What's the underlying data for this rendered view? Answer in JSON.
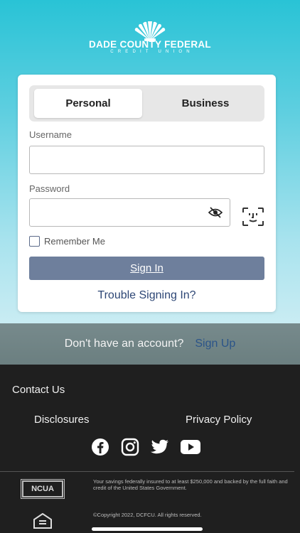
{
  "brand": {
    "name": "DADE COUNTY FEDERAL",
    "subtitle": "CREDIT UNION"
  },
  "login": {
    "tabs": [
      {
        "label": "Personal",
        "active": true
      },
      {
        "label": "Business",
        "active": false
      }
    ],
    "username_label": "Username",
    "username_value": "",
    "password_label": "Password",
    "password_value": "",
    "remember_label": "Remember Me",
    "remember_checked": false,
    "signin_label": "Sign In",
    "trouble_label": "Trouble Signing In?"
  },
  "signup": {
    "question": "Don't have an account?",
    "link": "Sign Up"
  },
  "footer": {
    "contact": "Contact Us",
    "disclosures": "Disclosures",
    "privacy": "Privacy Policy",
    "social_icons": [
      "facebook-icon",
      "instagram-icon",
      "twitter-icon",
      "youtube-icon"
    ],
    "ncua": "NCUA",
    "insured_text": "Your savings federally insured to at least $250,000 and backed by the full faith and credit of the United States Government.",
    "copyright": "©Copyright 2022, DCFCU. All rights reserved."
  },
  "colors": {
    "accent": "#2d4675",
    "signin_button": "#6e7f9c",
    "hero_top": "#29c3d6",
    "footer_bg": "#1f1f1f"
  }
}
